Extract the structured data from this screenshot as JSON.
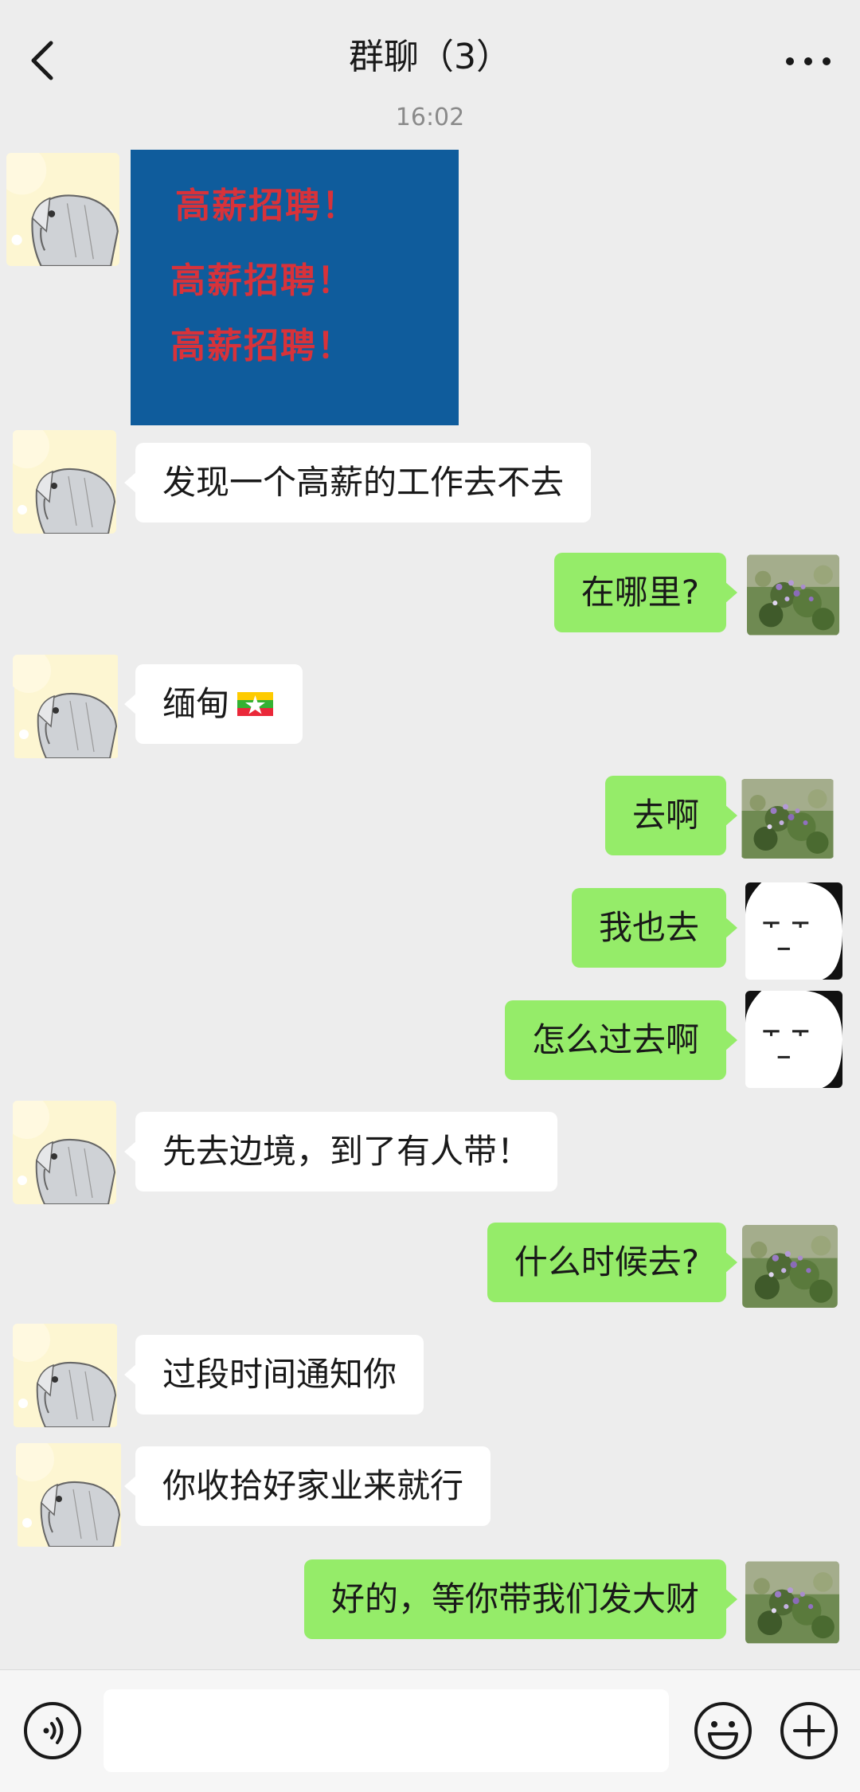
{
  "header": {
    "title": "群聊（3）",
    "back_icon": "chevron-left-icon",
    "more_icon": "more-dots-icon"
  },
  "timestamp": "16:02",
  "image_message": {
    "lines": [
      "高薪招聘！",
      "高薪招聘！",
      "高薪招聘！"
    ]
  },
  "messages": [
    {
      "side": "left",
      "text": "发现一个高薪的工作去不去"
    },
    {
      "side": "right",
      "text": "在哪里?"
    },
    {
      "side": "left",
      "text": "缅甸",
      "emoji": "myanmar-flag-icon"
    },
    {
      "side": "right",
      "text": "去啊"
    },
    {
      "side": "right",
      "text": "我也去"
    },
    {
      "side": "right",
      "text": "怎么过去啊"
    },
    {
      "side": "left",
      "text": "先去边境，到了有人带！"
    },
    {
      "side": "right",
      "text": "什么时候去?"
    },
    {
      "side": "left",
      "text": "过段时间通知你"
    },
    {
      "side": "left",
      "text": "你收拾好家业来就行"
    },
    {
      "side": "right",
      "text": "好的，等你带我们发大财"
    }
  ],
  "colors": {
    "background": "#ededed",
    "bubble_right": "#95ec69",
    "bubble_left": "#ffffff",
    "poster_bg": "#0f5c9c",
    "poster_text": "#d8323a"
  },
  "input": {
    "value": "",
    "placeholder": ""
  },
  "bottom_icons": [
    "voice-icon",
    "emoji-icon",
    "plus-icon"
  ]
}
